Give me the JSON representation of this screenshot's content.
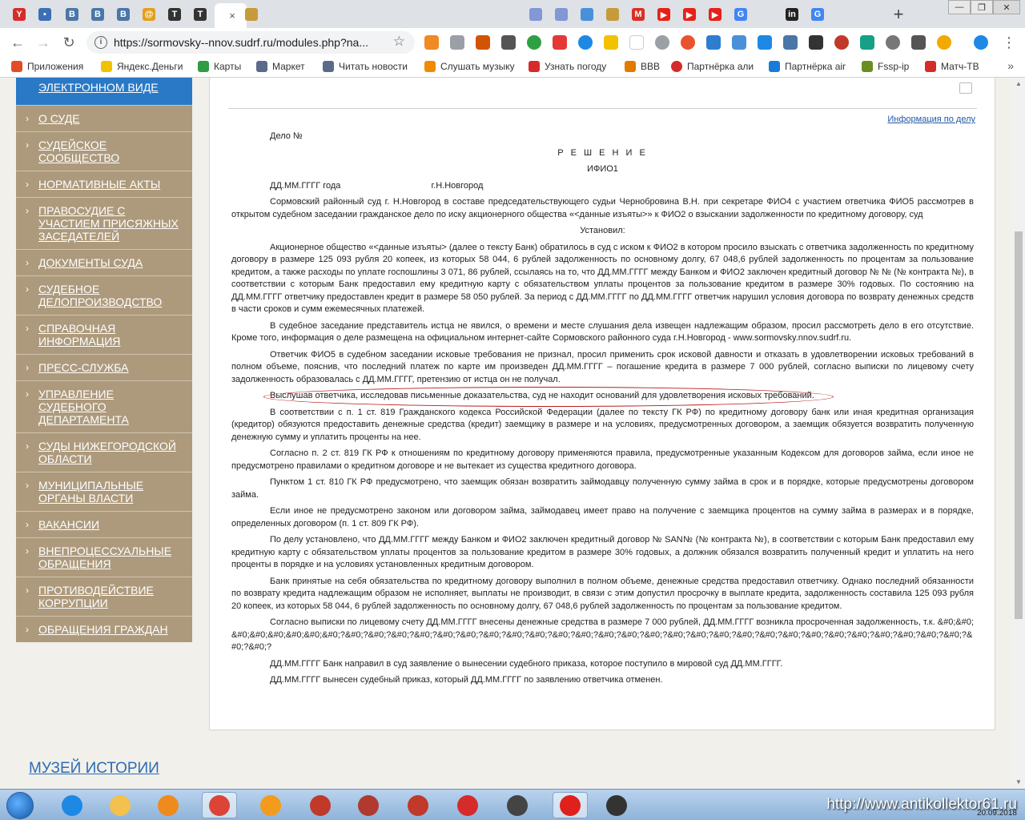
{
  "browser": {
    "tabs": [
      {
        "icon": "yandex-icon",
        "color": "#d62b2b",
        "glyph": "Y"
      },
      {
        "icon": "chat-icon",
        "color": "#3b6fb6",
        "glyph": "▪"
      },
      {
        "icon": "vk-icon",
        "color": "#4a76a8",
        "glyph": "В"
      },
      {
        "icon": "vk-icon",
        "color": "#4a76a8",
        "glyph": "В"
      },
      {
        "icon": "vk-icon",
        "color": "#4a76a8",
        "glyph": "В"
      },
      {
        "icon": "at-icon",
        "color": "#e2a11b",
        "glyph": "@"
      },
      {
        "icon": "law-icon",
        "color": "#333333",
        "glyph": "T"
      },
      {
        "icon": "law-icon",
        "color": "#333333",
        "glyph": "T"
      }
    ],
    "active_tab_close": "×",
    "new_tab_label": "+",
    "url": "https://sormovsky--nnov.sudrf.ru/modules.php?na...",
    "info_glyph": "i",
    "star_glyph": "☆"
  },
  "bookmarks": [
    {
      "label": "Приложения",
      "color": "#e34c26"
    },
    {
      "label": "Яндекс.Деньги",
      "color": "#f2c200"
    },
    {
      "label": "Карты",
      "color": "#2e9d44"
    },
    {
      "label": "Маркет",
      "color": "#5a6b8a"
    },
    {
      "label": "Читать новости",
      "color": "#5a6b8a"
    },
    {
      "label": "Слушать музыку",
      "color": "#f08a00"
    },
    {
      "label": "Узнать погоду",
      "color": "#d62b2b"
    },
    {
      "label": "BBB",
      "color": "#e07b00"
    },
    {
      "label": "Партнёрка али",
      "color": "#d62b2b"
    },
    {
      "label": "Партнёрка air",
      "color": "#1a7ad8"
    },
    {
      "label": "Fssp-ip",
      "color": "#6b8e23"
    },
    {
      "label": "Матч-ТВ",
      "color": "#d62b2b"
    }
  ],
  "bookmarks_more": "»",
  "sidebar": {
    "active_item": "ЭЛЕКТРОННОМ ВИДЕ",
    "items": [
      "О СУДЕ",
      "СУДЕЙСКОЕ СООБЩЕСТВО",
      "НОРМАТИВНЫЕ АКТЫ",
      "ПРАВОСУДИЕ С УЧАСТИЕМ ПРИСЯЖНЫХ ЗАСЕДАТЕЛЕЙ",
      "ДОКУМЕНТЫ СУДА",
      "СУДЕБНОЕ ДЕЛОПРОИЗВОДСТВО",
      "СПРАВОЧНАЯ ИНФОРМАЦИЯ",
      "ПРЕСС-СЛУЖБА",
      "УПРАВЛЕНИЕ СУДЕБНОГО ДЕПАРТАМЕНТА",
      "СУДЫ НИЖЕГОРОДСКОЙ ОБЛАСТИ",
      "МУНИЦИПАЛЬНЫЕ ОРГАНЫ ВЛАСТИ",
      "ВАКАНСИИ",
      "ВНЕПРОЦЕССУАЛЬНЫЕ ОБРАЩЕНИЯ",
      "ПРОТИВОДЕЙСТВИЕ КОРРУПЦИИ",
      "ОБРАЩЕНИЯ ГРАЖДАН"
    ],
    "chevron": "›",
    "museum_link": "МУЗЕЙ ИСТОРИИ"
  },
  "document": {
    "info_link": "Информация по делу",
    "case_no": "Дело №",
    "title": "Р Е Ш Е Н И Е",
    "name": "ИФИО1",
    "date_place": "ДД.ММ.ГГГГ года                                     г.Н.Новгород",
    "intro": "Сормовский районный суд г. Н.Новгород в составе председательствующего судьи Чернобровина В.Н. при секретаре ФИО4 с участием ответчика ФИО5 рассмотрев в открытом судебном заседании гражданское дело по иску акционерного общества «<данные изъяты>» к ФИО2 о взыскании задолженности по кредитному договору, суд",
    "established": "Установил:",
    "p1": "Акционерное общество «<данные изъяты> (далее о тексту Банк) обратилось в суд с иском к ФИО2 в котором просило взыскать с ответчика задолженность по кредитному договору в размере 125 093 рубля 20 копеек, из которых 58 044, 6 рублей задолженность по основному долгу, 67 048,6 рублей задолженность по процентам за пользование кредитом, а также расходы по уплате госпошлины 3 071, 86 рублей, ссылаясь на то, что ДД.ММ.ГГГГ между Банком и ФИО2 заключен кредитный договор № № (№ контракта №), в соответствии с которым Банк предоставил ему кредитную карту с обязательством уплаты процентов за пользование кредитом в размере 30% годовых. По состоянию на ДД.ММ.ГГГГ ответчику предоставлен кредит в размере 58 050 рублей. За период с ДД.ММ.ГГГГ по ДД.ММ.ГГГГ ответчик нарушил условия договора по возврату денежных средств в части сроков и сумм ежемесячных платежей.",
    "p2": "В судебное заседание представитель истца не явился, о времени и месте слушания дела извещен надлежащим образом, просил рассмотреть дело в его отсутствие. Кроме того, информация о деле размещена на официальном интернет-сайте Сормовского районного суда г.Н.Новгород - www.sormovsky.nnov.sudrf.ru.",
    "p3": "Ответчик ФИО5 в судебном заседании исковые требования не признал, просил применить срок исковой давности и отказать в удовлетворении исковых требований в полном объеме, пояснив, что последний платеж по карте им произведен ДД.ММ.ГГГГ – погашение кредита в размере 7 000 рублей, согласно выписки по лицевому счету задолженность образовалась с ДД.ММ.ГГГГ, претензию от истца он не получал.",
    "p4_highlight": "Выслушав ответчика, исследовав письменные доказательства, суд не находит оснований для удовлетворения исковых требований.",
    "p5": "В соответствии с п. 1 ст. 819 Гражданского кодекса Российской Федерации (далее по тексту ГК РФ) по кредитному договору банк или иная кредитная организация (кредитор) обязуются предоставить денежные средства (кредит) заемщику в размере и на условиях, предусмотренных договором, а заемщик обязуется возвратить полученную денежную сумму и уплатить проценты на нее.",
    "p6": "Согласно п. 2 ст. 819 ГК РФ к отношениям по кредитному договору применяются правила, предусмотренные указанным Кодексом для договоров займа, если иное не предусмотрено правилами о кредитном договоре и не вытекает из существа кредитного договора.",
    "p7": "Пунктом 1 ст. 810 ГК РФ предусмотрено, что заемщик обязан возвратить займодавцу полученную сумму займа в срок и в порядке, которые предусмотрены договором займа.",
    "p8": "Если иное не предусмотрено законом или договором займа, займодавец имеет право на получение с заемщика процентов на сумму займа в размерах и в порядке, определенных договором (п. 1 ст. 809 ГК РФ).",
    "p9": "По делу установлено, что ДД.ММ.ГГГГ между Банком и ФИО2 заключен кредитный договор № SAN№ (№ контракта №), в соответствии с которым Банк предоставил ему кредитную карту с обязательством уплаты процентов за пользование кредитом в размере 30% годовых, а должник обязался возвратить полученный кредит и уплатить на него проценты в порядке и на условиях установленных кредитным договором.",
    "p10": "Банк принятые на себя обязательства по кредитному договору выполнил в полном объеме, денежные средства предоставил ответчику. Однако последний обязанности по возврату кредита надлежащим образом не исполняет, выплаты не производит, в связи с этим допустил просрочку в выплате кредита, задолженность составила 125 093 рубля 20 копеек, из которых 58 044, 6 рублей задолженность по основному долгу, 67 048,6 рублей задолженность по процентам за пользование кредитом.",
    "p11": "Согласно выписки по лицевому счету ДД.ММ.ГГГГ внесены денежные средства в размере 7 000 рублей, ДД.ММ.ГГГГ возникла просроченная задолженность, т.к. &#0;&#0;&#0;&#0;&#0;&#0;&#0;&#0;?&#0;?&#0;?&#0;?&#0;?&#0;?&#0;?&#0;?&#0;?&#0;?&#0;?&#0;?&#0;?&#0;?&#0;?&#0;?&#0;?&#0;?&#0;?&#0;?&#0;?&#0;?&#0;?&#0;?&#0;?&#0;?&#0;?&#0;?&#0;?&#0;?",
    "p12": "ДД.ММ.ГГГГ Банк направил в суд заявление о вынесении судебного приказа, которое поступило в мировой суд ДД.ММ.ГГГГ.",
    "p13": "ДД.ММ.ГГГГ вынесен судебный приказ, который ДД.ММ.ГГГГ по заявлению ответчика отменен."
  },
  "taskbar": {
    "apps": [
      {
        "name": "ie-icon",
        "color": "#1e88e5"
      },
      {
        "name": "explorer-icon",
        "color": "#f2c14e"
      },
      {
        "name": "media-player-icon",
        "color": "#ef8a1d"
      },
      {
        "name": "chrome-icon",
        "color": "#db4437"
      },
      {
        "name": "sip-icon",
        "color": "#f29b1d"
      },
      {
        "name": "book-icon",
        "color": "#c0392b"
      },
      {
        "name": "film-icon",
        "color": "#b03a2e"
      },
      {
        "name": "record-icon",
        "color": "#c0392b"
      },
      {
        "name": "download-icon",
        "color": "#d62b2b"
      },
      {
        "name": "tools-icon",
        "color": "#444444"
      },
      {
        "name": "opera-icon",
        "color": "#e0201b"
      },
      {
        "name": "obs-icon",
        "color": "#333333"
      }
    ],
    "watermark": "http://www.antikollektor61.ru",
    "date": "20.09.2018"
  }
}
